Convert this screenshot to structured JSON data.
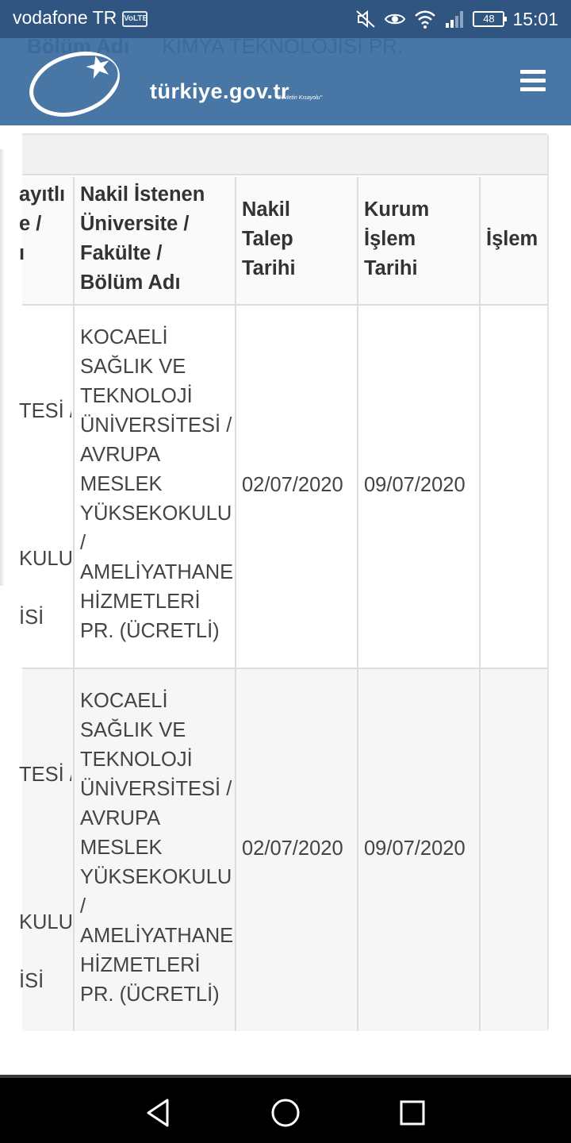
{
  "status_bar": {
    "carrier": "vodafone TR",
    "volte": "VoLTE",
    "battery": "48",
    "time": "15:01",
    "icons": [
      "mute-icon",
      "eye-icon",
      "wifi-icon",
      "signal-icon",
      "battery-icon"
    ]
  },
  "header": {
    "ghost_label": "Bölüm Adı",
    "ghost_value": "KİMYA TEKNOLOJİSİ PR.",
    "logo_text": "türkiye.gov.tr",
    "logo_sub": "\"Devletin Kısayolu\"",
    "menu_icon": "hamburger-menu-icon"
  },
  "table": {
    "headers": {
      "partial": "ayıtlı\ne /\nı",
      "target": "Nakil İstenen\nÜniversite /\nFakülte /\nBölüm Adı",
      "request_date": "Nakil\nTalep\nTarihi",
      "process_date": "Kurum\nİşlem\nTarihi",
      "action": "İşlem"
    },
    "rows": [
      {
        "partial_a": "TESİ /",
        "partial_b": "KULU",
        "partial_c": "İSİ",
        "target": "KOCAELİ\nSAĞLIK VE\nTEKNOLOJİ\nÜNİVERSİTESİ /\nAVRUPA\nMESLEK\nYÜKSEKOKULU\n/\nAMELİYATHANE\nHİZMETLERİ\nPR. (ÜCRETLİ)",
        "request_date": "02/07/2020",
        "process_date": "09/07/2020",
        "action": ""
      },
      {
        "partial_a": "TESİ /",
        "partial_b": "KULU",
        "partial_c": "İSİ",
        "target": "KOCAELİ\nSAĞLIK VE\nTEKNOLOJİ\nÜNİVERSİTESİ /\nAVRUPA\nMESLEK\nYÜKSEKOKULU\n/\nAMELİYATHANE\nHİZMETLERİ\nPR. (ÜCRETLİ)",
        "request_date": "02/07/2020",
        "process_date": "09/07/2020",
        "action": ""
      }
    ]
  },
  "nav": {
    "icons": [
      "back-icon",
      "home-icon",
      "recents-icon"
    ]
  }
}
